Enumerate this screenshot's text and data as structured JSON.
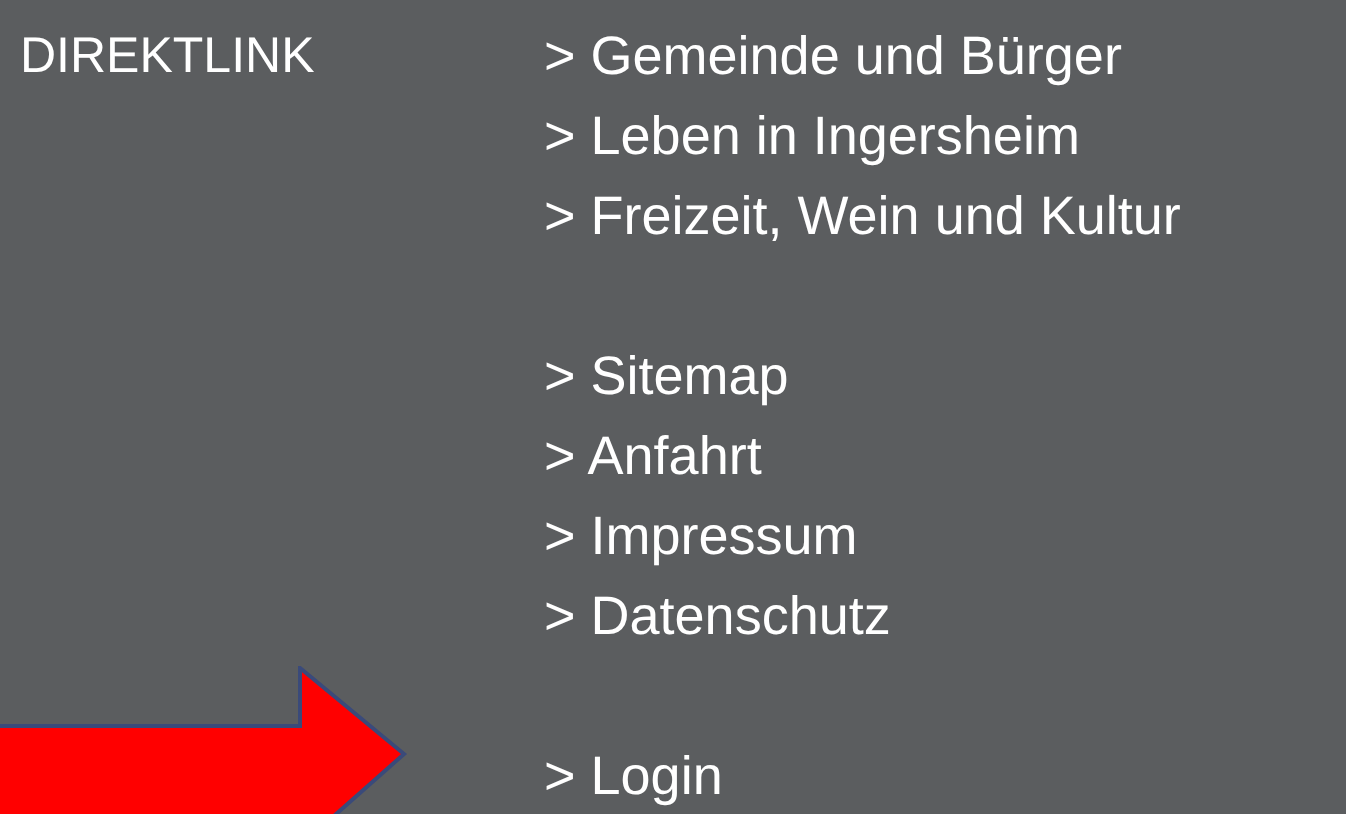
{
  "heading": "DIREKTLINK",
  "link_groups": [
    [
      "> Gemeinde und Bürger",
      "> Leben in Ingersheim",
      "> Freizeit, Wein und Kultur"
    ],
    [
      "> Sitemap",
      "> Anfahrt",
      "> Impressum",
      "> Datenschutz"
    ],
    [
      "> Login"
    ]
  ]
}
